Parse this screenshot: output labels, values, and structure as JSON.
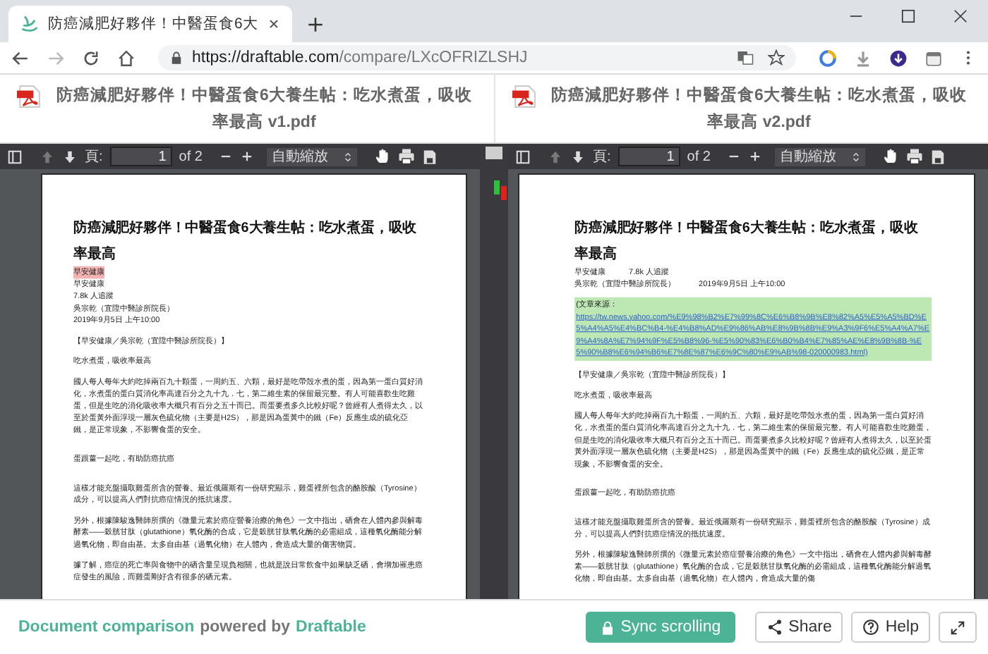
{
  "browser": {
    "tab_title": "防癌減肥好夥伴！中醫蛋食6大",
    "url_host": "https://draftable.com",
    "url_path": "/compare/LXcOFRIZLSHJ"
  },
  "documents": [
    {
      "file_name": "防癌減肥好夥伴！中醫蛋食6大養生帖：吃水煮蛋，吸收率最高 v1.pdf",
      "toolbar": {
        "page_label": "頁:",
        "page": "1",
        "page_count": "of 2",
        "zoom": "自動縮放"
      },
      "page": {
        "title": "防癌減肥好夥伴！中醫蛋食6大養生帖：吃水煮蛋，吸收率最高",
        "blocks": [
          {
            "kind": "meta",
            "deleted": true,
            "inserted": false,
            "parts": [
              "早安健康"
            ]
          },
          {
            "kind": "meta",
            "deleted": false,
            "inserted": false,
            "parts": [
              "早安健康"
            ]
          },
          {
            "kind": "meta",
            "deleted": false,
            "inserted": false,
            "parts": [
              "7.8k 人追蹤"
            ]
          },
          {
            "kind": "meta",
            "deleted": false,
            "inserted": false,
            "parts": [
              "吳宗乾（宜陞中醫診所院長）"
            ]
          },
          {
            "kind": "meta",
            "deleted": false,
            "inserted": false,
            "parts": [
              "2019年9月5日 上午10:00"
            ]
          },
          {
            "kind": "paragraph",
            "deleted": false,
            "inserted": false,
            "parts": [
              "【早安健康／吳宗乾（宜陞中醫診所院長）】"
            ]
          },
          {
            "kind": "paragraph",
            "deleted": false,
            "inserted": false,
            "parts": [
              "吃水煮蛋，吸收率最高"
            ]
          },
          {
            "kind": "paragraph",
            "deleted": false,
            "inserted": false,
            "parts": [
              "國人每人每年大約吃掉兩百九十顆蛋，一周約五、六顆，最好是吃帶殼水煮的蛋，因為第一蛋白質好消化，水煮蛋的蛋白質消化率高達百分之九十九．七，第二維生素的保留最完整。有人可能喜歡生吃雞蛋，但是生吃的消化吸收率大概只有百分之五十而已。而蛋要煮多久比較好呢？曾經有人煮得太久，以至於蛋黃外面浮現一層灰色硫化物（主要是H2S），那是因為蛋黃中的鐵（Fe）反應生成的硫化亞鐵，是正常現象，不影響食蛋的安全。"
            ]
          },
          {
            "kind": "section",
            "deleted": false,
            "inserted": false,
            "parts": [
              "蛋跟薑一起吃，有助防癌抗癌"
            ]
          },
          {
            "kind": "section",
            "deleted": false,
            "inserted": false,
            "parts": [
              "這樣才能充盤攝取雞蛋所含的營養。最近俄羅斯有一份研究顯示，雞蛋裡所包含的酪胺酸（Tyrosine）成分，可以提高人們對抗癌症情況的抵抗速度。"
            ]
          },
          {
            "kind": "paragraph",
            "deleted": false,
            "inserted": false,
            "parts": [
              "另外，根據陳駿逸醫師所撰的《微量元素於癌症營養治療的角色》一文中指出，硒會在人體內參與解毒酵素——穀胱甘肽（glutathione）氧化酶的合成，它是穀胱甘肽氧化酶的必需組成，這種氧化酶能分解過氧化物，即自由基。太多自由基（過氧化物）在人體內，會造成大量的傷害物質。"
            ]
          },
          {
            "kind": "paragraph",
            "deleted": false,
            "inserted": false,
            "parts": [
              "據了解，癌症的死亡率與食物中的硒含量呈現負相關，也就是說日常飲食中如果缺乏硒，會增加罹患癌症發生的風險，而雞蛋剛好含有很多的硒元素。"
            ]
          }
        ]
      }
    },
    {
      "file_name": "防癌減肥好夥伴！中醫蛋食6大養生帖：吃水煮蛋，吸收率最高 v2.pdf",
      "toolbar": {
        "page_label": "頁:",
        "page": "1",
        "page_count": "of 2",
        "zoom": "自動縮放"
      },
      "page": {
        "title": "防癌減肥好夥伴！中醫蛋食6大養生帖：吃水煮蛋，吸收率最高",
        "blocks": [
          {
            "kind": "meta",
            "deleted": false,
            "inserted": false,
            "parts": [
              "早安健康",
              "7.8k 人追蹤"
            ]
          },
          {
            "kind": "meta",
            "deleted": false,
            "inserted": false,
            "parts": [
              "吳宗乾（宜陞中醫診所院長）",
              "2019年9月5日 上午10:00"
            ]
          },
          {
            "kind": "source",
            "deleted": false,
            "inserted": true,
            "label": "(文章來源：",
            "link": "https://tw.news.yahoo.com/%E9%98%B2%E7%99%8C%E6%B8%9B%E8%82%A5%E5%A5%BD%E5%A4%A5%E4%BC%B4-%E4%B8%AD%E9%86%AB%E8%9B%8B%E9%A3%9F6%E5%A4%A7%E9%A4%8A%E7%94%9F%E5%B8%96-%E5%90%83%E6%B0%B4%E7%85%AE%E8%9B%8B-%E5%90%B8%E6%94%B6%E7%8E%87%E6%9C%80%E9%AB%98-020000983.html)"
          },
          {
            "kind": "paragraph",
            "deleted": false,
            "inserted": false,
            "parts": [
              "【早安健康／吳宗乾（宜陞中醫診所院長）】"
            ]
          },
          {
            "kind": "paragraph",
            "deleted": false,
            "inserted": false,
            "parts": [
              "吃水煮蛋，吸收率最高"
            ]
          },
          {
            "kind": "paragraph",
            "deleted": false,
            "inserted": false,
            "parts": [
              "國人每人每年大約吃掉兩百九十顆蛋，一周約五、六顆，最好是吃帶殼水煮的蛋，因為第一蛋白質好消化，水煮蛋的蛋白質消化率高達百分之九十九．七，第二維生素的保留最完整。有人可能喜歡生吃雞蛋，但是生吃的消化吸收率大概只有百分之五十而已。而蛋要煮多久比較好呢？曾經有人煮得太久，以至於蛋黃外面浮現一層灰色硫化物（主要是H2S），那是因為蛋黃中的鐵（Fe）反應生成的硫化亞鐵，是正常現象，不影響食蛋的安全。"
            ]
          },
          {
            "kind": "section",
            "deleted": false,
            "inserted": false,
            "parts": [
              "蛋跟薑一起吃，有助防癌抗癌"
            ]
          },
          {
            "kind": "section",
            "deleted": false,
            "inserted": false,
            "parts": [
              "這樣才能充盤攝取雞蛋所含的營養。最近俄羅斯有一份研究顯示，雞蛋裡所包含的酪胺酸（Tyrosine）成分，可以提高人們對抗癌症情況的抵抗速度。"
            ]
          },
          {
            "kind": "paragraph",
            "deleted": false,
            "inserted": false,
            "parts": [
              "另外，根據陳駿逸醫師所撰的《微量元素於癌症營養治療的角色》一文中指出，硒會在人體內參與解毒酵素——穀胱甘肽（glutathione）氧化酶的合成，它是穀胱甘肽氧化酶的必需組成，這種氧化酶能分解過氧化物，即自由基。太多自由基（過氧化物）在人體內，會造成大量的傷"
            ]
          }
        ]
      }
    }
  ],
  "change_markers": [
    {
      "color": "#2fbf3f"
    },
    {
      "color": "#e0201c"
    }
  ],
  "footer": {
    "link": "Document comparison",
    "text": "powered by",
    "brand": "Draftable",
    "buttons": [
      {
        "kind": "sync",
        "label": "Sync scrolling"
      },
      {
        "kind": "share",
        "label": "Share"
      },
      {
        "kind": "help",
        "label": "Help"
      },
      {
        "kind": "expand"
      }
    ]
  }
}
